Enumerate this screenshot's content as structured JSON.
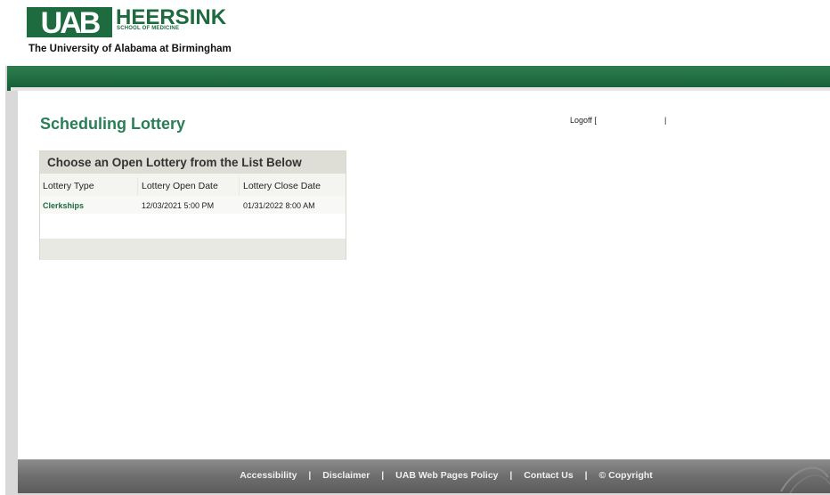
{
  "header": {
    "logo_mark": "UAB",
    "logo_name": "HEERSINK",
    "logo_sub": "SCHOOL OF MEDICINE",
    "university": "The University of Alabama at Birmingham"
  },
  "page": {
    "title": "Scheduling Lottery",
    "logoff_label": "Logoff [",
    "logoff_sep": "|"
  },
  "panel": {
    "heading": "Choose an Open Lottery from the List Below",
    "columns": [
      "Lottery Type",
      "Lottery Open Date",
      "Lottery Close Date"
    ],
    "rows": [
      {
        "type": "Clerkships",
        "open": "12/03/2021 5:00 PM",
        "close": "01/31/2022 8:00 AM"
      }
    ]
  },
  "footer": {
    "links": [
      "Accessibility",
      "Disclaimer",
      "UAB Web Pages Policy",
      "Contact Us",
      "© Copyright"
    ],
    "separator": "|"
  },
  "colors": {
    "brand_green": "#1e6b3f",
    "title_green": "#2a7e57",
    "footer_gray": "#6e6e6e"
  }
}
